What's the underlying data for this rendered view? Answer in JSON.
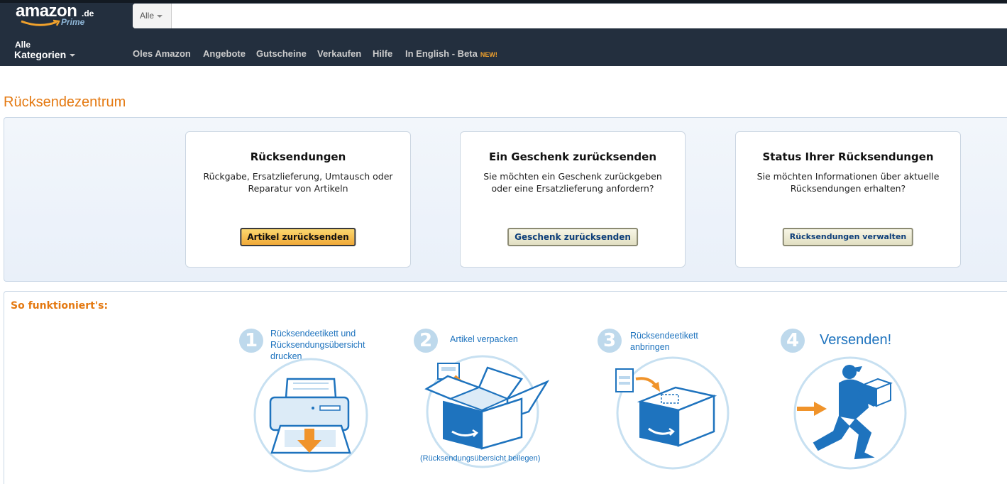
{
  "header": {
    "logo": {
      "text": "amazon",
      "tld": ".de",
      "subtitle": "Prime"
    },
    "search": {
      "dropdown_label": "Alle",
      "placeholder": "",
      "value": ""
    },
    "categories": {
      "small": "Alle",
      "big": "Kategorien"
    },
    "nav": [
      "Oles Amazon",
      "Angebote",
      "Gutscheine",
      "Verkaufen",
      "Hilfe",
      "In English - Beta"
    ],
    "nav_badge": "NEW!",
    "colors": {
      "background": "#232f3e",
      "badge": "#f0a12c"
    }
  },
  "page_title": "Rücksendezentrum",
  "cards": [
    {
      "title": "Rücksendungen",
      "desc_line1": "Rückgabe, Ersatzlieferung, Umtausch oder",
      "desc_line2": "Reparatur von Artikeln",
      "button": "Artikel zurücksenden"
    },
    {
      "title": "Ein Geschenk zurücksenden",
      "desc_line1": "Sie möchten ein Geschenk zurückgeben",
      "desc_line2": "oder eine Ersatzlieferung anfordern?",
      "button": "Geschenk zurücksenden"
    },
    {
      "title": "Status Ihrer Rücksendungen",
      "desc_line1": "Sie möchten Informationen über aktuelle",
      "desc_line2": "Rücksendungen erhalten?",
      "button": "Rücksendungen verwalten"
    }
  ],
  "how_it_works": {
    "title": "So funktioniert's:",
    "steps": [
      {
        "number": "1",
        "line1": "Rücksendeetikett und",
        "line2": "Rücksendungsübersicht",
        "line3": "drucken",
        "icon": "printer-icon"
      },
      {
        "number": "2",
        "line1": "Artikel verpacken",
        "note": "(Rücksendungsübersicht beilegen)",
        "icon": "open-box-icon"
      },
      {
        "number": "3",
        "line1": "Rücksendeetikett",
        "line2": "anbringen",
        "icon": "label-box-icon"
      },
      {
        "number": "4",
        "line1": "Versenden!",
        "icon": "delivery-man-icon"
      }
    ]
  },
  "colors": {
    "accent_orange": "#e47911",
    "link_blue": "#1e73be",
    "step_circle": "#bed9ec"
  }
}
